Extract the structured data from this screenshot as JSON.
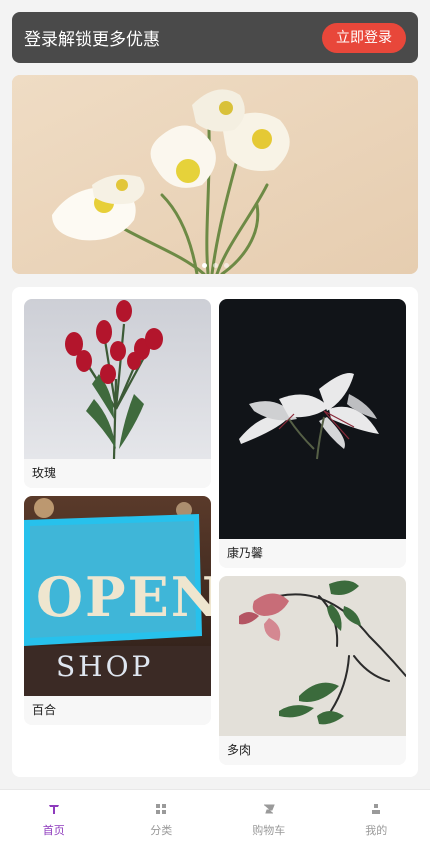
{
  "login_bar": {
    "text": "登录解锁更多优惠",
    "button": "立即登录"
  },
  "banner": {
    "image": "white-poppies-photo",
    "dots": 3,
    "active_dot": 0
  },
  "categories": [
    {
      "label": "玫瑰",
      "image": "red-tulips-photo"
    },
    {
      "label": "康乃馨",
      "image": "white-lily-dark-photo"
    },
    {
      "label": "百合",
      "image": "open-shop-sign-photo"
    },
    {
      "label": "多肉",
      "image": "pink-flower-branch-photo"
    }
  ],
  "tabbar": {
    "active_color": "#8e3bbd",
    "items": [
      {
        "label": "首页",
        "icon": "home-icon"
      },
      {
        "label": "分类",
        "icon": "grid-icon"
      },
      {
        "label": "购物车",
        "icon": "cart-icon"
      },
      {
        "label": "我的",
        "icon": "user-icon"
      }
    ]
  }
}
